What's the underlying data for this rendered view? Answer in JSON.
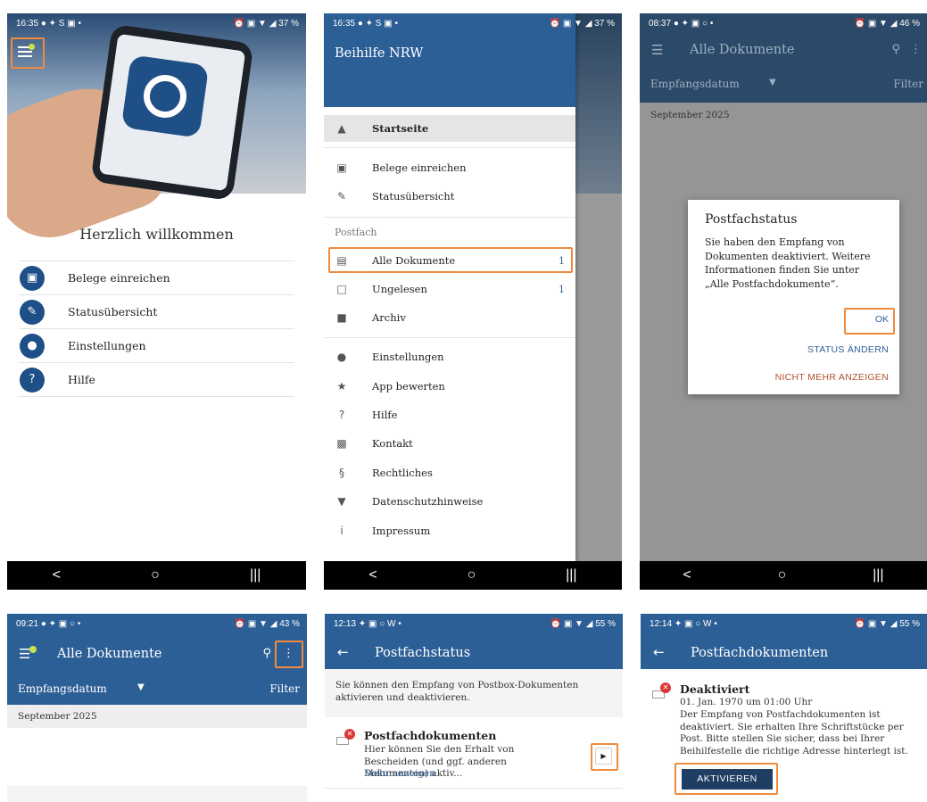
{
  "colors": {
    "primary": "#2d5f97",
    "highlight": "#f08a3c",
    "error": "#d93b3b",
    "dark_button": "#1f3e63",
    "warning_text": "#b5502f"
  },
  "screen1": {
    "status": {
      "time": "16:35",
      "left_icons": "● ✦ S ▣ •",
      "right_icons": "⏰ ▣ ▼ ◢",
      "battery": "37 %"
    },
    "welcome": "Herzlich willkommen",
    "menu": [
      {
        "label": "Belege einreichen",
        "icon": "camera-icon",
        "glyph": "▣"
      },
      {
        "label": "Statusübersicht",
        "icon": "document-edit-icon",
        "glyph": "✎"
      },
      {
        "label": "Einstellungen",
        "icon": "person-icon",
        "glyph": "●"
      },
      {
        "label": "Hilfe",
        "icon": "help-icon",
        "glyph": "?"
      }
    ],
    "nav": {
      "back": "<",
      "home": "○",
      "recent": "|||"
    }
  },
  "screen2": {
    "status": {
      "time": "16:35",
      "left_icons": "● ✦ S ▣ •",
      "right_icons": "⏰ ▣ ▼ ◢",
      "battery": "37 %"
    },
    "drawer_title": "Beihilfe NRW",
    "section_postfach": "Postfach",
    "items": {
      "startseite": "Startseite",
      "belege": "Belege einreichen",
      "status": "Statusübersicht",
      "alle_dokumente": "Alle Dokumente",
      "alle_dokumente_count": "1",
      "ungelesen": "Ungelesen",
      "ungelesen_count": "1",
      "archiv": "Archiv",
      "einstellungen": "Einstellungen",
      "app_bewerten": "App bewerten",
      "hilfe": "Hilfe",
      "kontakt": "Kontakt",
      "rechtliches": "Rechtliches",
      "datenschutz": "Datenschutzhinweise",
      "impressum": "Impressum"
    },
    "nav": {
      "back": "<",
      "home": "○",
      "recent": "|||"
    }
  },
  "screen3": {
    "status": {
      "time": "08:37",
      "left_icons": "● ✦ ▣ ○ •",
      "right_icons": "⏰ ▣ ▼ ◢",
      "battery": "46 %"
    },
    "title": "Alle Dokumente",
    "sort_label": "Empfangsdatum",
    "filter_label": "Filter",
    "month": "September 2025",
    "dialog": {
      "title": "Postfachstatus",
      "text": "Sie haben den Empfang von Dokumenten deaktiviert. Weitere Informationen finden Sie unter „Alle Postfachdokumente“.",
      "ok": "OK",
      "change_status": "STATUS ÄNDERN",
      "dont_show": "NICHT MEHR ANZEIGEN"
    },
    "nav": {
      "back": "<",
      "home": "○",
      "recent": "|||"
    }
  },
  "screen4": {
    "status": {
      "time": "09:21",
      "left_icons": "● ✦ ▣ ○ •",
      "right_icons": "⏰ ▣ ▼ ◢",
      "battery": "43 %"
    },
    "title": "Alle Dokumente",
    "sort_label": "Empfangsdatum",
    "filter_label": "Filter",
    "month": "September 2025"
  },
  "screen5": {
    "status": {
      "time": "12:13",
      "left_icons": "✦ ▣ ○ W •",
      "right_icons": "⏰ ▣ ▼ ◢",
      "battery": "55 %"
    },
    "title": "Postfachstatus",
    "intro": "Sie können den Empfang von Postbox-Dokumenten aktivieren und deaktivieren.",
    "item_title": "Postfachdokumenten",
    "item_desc": "Hier können Sie den Erhalt von Bescheiden (und ggf. anderen Dokumenten) aktiv...",
    "more": "Mehr anzeigen"
  },
  "screen6": {
    "status": {
      "time": "12:14",
      "left_icons": "✦ ▣ ○ W •",
      "right_icons": "⏰ ▣ ▼ ◢",
      "battery": "55 %"
    },
    "title": "Postfachdokumenten",
    "state": "Deaktiviert",
    "date": "01. Jan. 1970 um 01:00 Uhr",
    "text": "Der Empfang von Postfachdokumenten ist deaktiviert. Sie erhalten Ihre Schriftstücke per Post. Bitte stellen Sie sicher, dass bei Ihrer Beihilfestelle die richtige Adresse hinterlegt ist.",
    "button": "AKTIVIEREN"
  }
}
